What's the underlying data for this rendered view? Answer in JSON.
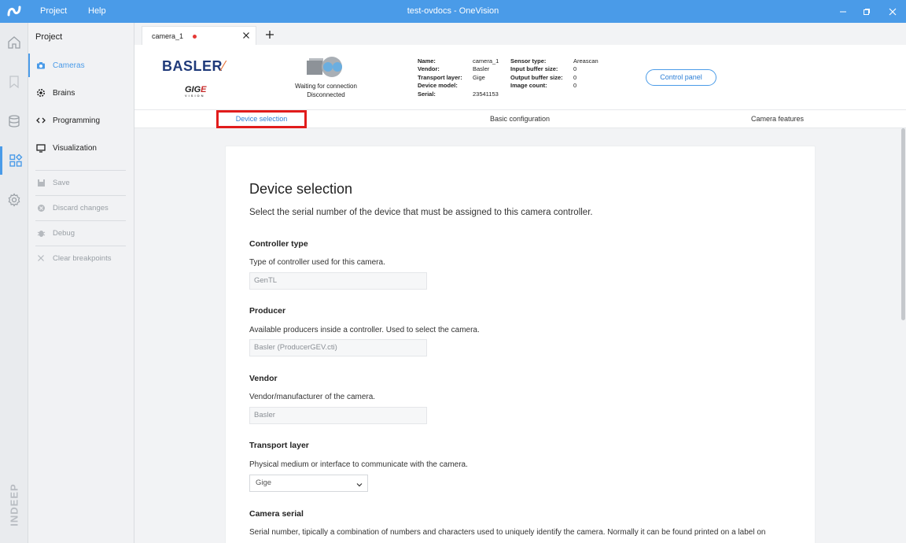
{
  "titlebar": {
    "menu": [
      "Project",
      "Help"
    ],
    "title": "test-ovdocs  -  OneVision",
    "accent": "#4a9be8"
  },
  "rail": {
    "icons": [
      "home-icon",
      "bookmark-icon",
      "database-icon",
      "apps-icon",
      "settings-icon"
    ],
    "brand": "INDEEP"
  },
  "panel": {
    "title": "Project",
    "items": [
      {
        "label": "Cameras",
        "icon": "camera-icon"
      },
      {
        "label": "Brains",
        "icon": "gear-cog-icon"
      },
      {
        "label": "Programming",
        "icon": "code-icon"
      },
      {
        "label": "Visualization",
        "icon": "monitor-icon"
      }
    ],
    "actions": [
      {
        "label": "Save",
        "icon": "save-icon"
      },
      {
        "label": "Discard changes",
        "icon": "discard-icon"
      },
      {
        "label": "Debug",
        "icon": "bug-icon"
      },
      {
        "label": "Clear breakpoints",
        "icon": "x-icon"
      }
    ]
  },
  "tab": {
    "label": "camera_1",
    "unsaved_color": "#e53935"
  },
  "header": {
    "brand": "BASLER",
    "gige": "GIGE",
    "gige_sub": "VISION",
    "status_line1": "Waiting for connection",
    "status_line2": "Disconnected",
    "info_left": [
      {
        "k": "Name:",
        "v": "camera_1"
      },
      {
        "k": "Vendor:",
        "v": "Basler"
      },
      {
        "k": "Transport layer:",
        "v": "Gige"
      },
      {
        "k": "Device model:",
        "v": ""
      },
      {
        "k": "Serial:",
        "v": "23541153"
      }
    ],
    "info_right": [
      {
        "k": "Sensor type:",
        "v": "Areascan"
      },
      {
        "k": "Input buffer size:",
        "v": "0"
      },
      {
        "k": "Output buffer size:",
        "v": "0"
      },
      {
        "k": "Image count:",
        "v": "0"
      }
    ],
    "control_panel": "Control panel"
  },
  "steps": [
    "Device selection",
    "Basic configuration",
    "Camera features"
  ],
  "content": {
    "title": "Device selection",
    "lead": "Select the serial number of the device that must be assigned to this camera controller.",
    "fields": [
      {
        "title": "Controller type",
        "desc": "Type of controller used for this camera.",
        "value": "GenTL"
      },
      {
        "title": "Producer",
        "desc": "Available producers inside a controller. Used to select the camera.",
        "value": "Basler (ProducerGEV.cti)"
      },
      {
        "title": "Vendor",
        "desc": "Vendor/manufacturer of the camera.",
        "value": "Basler"
      },
      {
        "title": "Transport layer",
        "desc": "Physical medium or interface to communicate with the camera.",
        "value": "Gige"
      },
      {
        "title": "Camera serial",
        "desc": "Serial number, tipically a combination of numbers and characters used to uniquely identify the camera. Normally it can be found printed on a label on"
      }
    ]
  }
}
